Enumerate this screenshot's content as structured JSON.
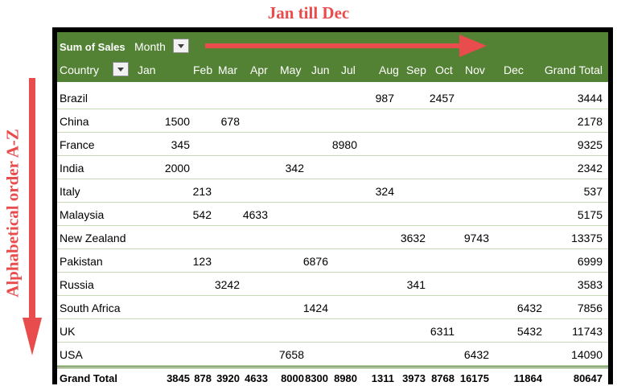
{
  "annotations": {
    "top": "Jan till Dec",
    "side": "Alphabetical order A-Z"
  },
  "colors": {
    "header_green": "#548235",
    "annotation_red": "#e84c4c",
    "frame": "#000000"
  },
  "pivot": {
    "values_label": "Sum of Sales",
    "column_field": "Month",
    "row_field": "Country",
    "months": [
      "Jan",
      "Feb",
      "Mar",
      "Apr",
      "May",
      "Jun",
      "Jul",
      "Aug",
      "Sep",
      "Oct",
      "Nov",
      "Dec"
    ],
    "grand_total_label": "Grand Total",
    "rows": [
      {
        "country": "Brazil",
        "values": [
          "",
          "",
          "",
          "",
          "",
          "",
          "",
          "987",
          "",
          "2457",
          "",
          ""
        ],
        "total": "3444"
      },
      {
        "country": "China",
        "values": [
          "1500",
          "",
          "678",
          "",
          "",
          "",
          "",
          "",
          "",
          "",
          "",
          ""
        ],
        "total": "2178"
      },
      {
        "country": "France",
        "values": [
          "345",
          "",
          "",
          "",
          "",
          "",
          "8980",
          "",
          "",
          "",
          "",
          ""
        ],
        "total": "9325"
      },
      {
        "country": "India",
        "values": [
          "2000",
          "",
          "",
          "",
          "342",
          "",
          "",
          "",
          "",
          "",
          "",
          ""
        ],
        "total": "2342"
      },
      {
        "country": "Italy",
        "values": [
          "",
          "213",
          "",
          "",
          "",
          "",
          "",
          "324",
          "",
          "",
          "",
          ""
        ],
        "total": "537"
      },
      {
        "country": "Malaysia",
        "values": [
          "",
          "542",
          "",
          "4633",
          "",
          "",
          "",
          "",
          "",
          "",
          "",
          ""
        ],
        "total": "5175"
      },
      {
        "country": "New Zealand",
        "values": [
          "",
          "",
          "",
          "",
          "",
          "",
          "",
          "",
          "3632",
          "",
          "9743",
          ""
        ],
        "total": "13375"
      },
      {
        "country": "Pakistan",
        "values": [
          "",
          "123",
          "",
          "",
          "",
          "6876",
          "",
          "",
          "",
          "",
          "",
          ""
        ],
        "total": "6999"
      },
      {
        "country": "Russia",
        "values": [
          "",
          "",
          "3242",
          "",
          "",
          "",
          "",
          "",
          "341",
          "",
          "",
          ""
        ],
        "total": "3583"
      },
      {
        "country": "South Africa",
        "values": [
          "",
          "",
          "",
          "",
          "",
          "1424",
          "",
          "",
          "",
          "",
          "",
          "6432"
        ],
        "total": "7856"
      },
      {
        "country": "UK",
        "values": [
          "",
          "",
          "",
          "",
          "",
          "",
          "",
          "",
          "",
          "6311",
          "",
          "5432"
        ],
        "total": "11743"
      },
      {
        "country": "USA",
        "values": [
          "",
          "",
          "",
          "",
          "7658",
          "",
          "",
          "",
          "",
          "",
          "6432",
          ""
        ],
        "total": "14090"
      }
    ],
    "grand_total": {
      "label": "Grand Total",
      "values": [
        "3845",
        "878",
        "3920",
        "4633",
        "8000",
        "8300",
        "8980",
        "1311",
        "3973",
        "8768",
        "16175",
        "11864"
      ],
      "total": "80647"
    }
  }
}
